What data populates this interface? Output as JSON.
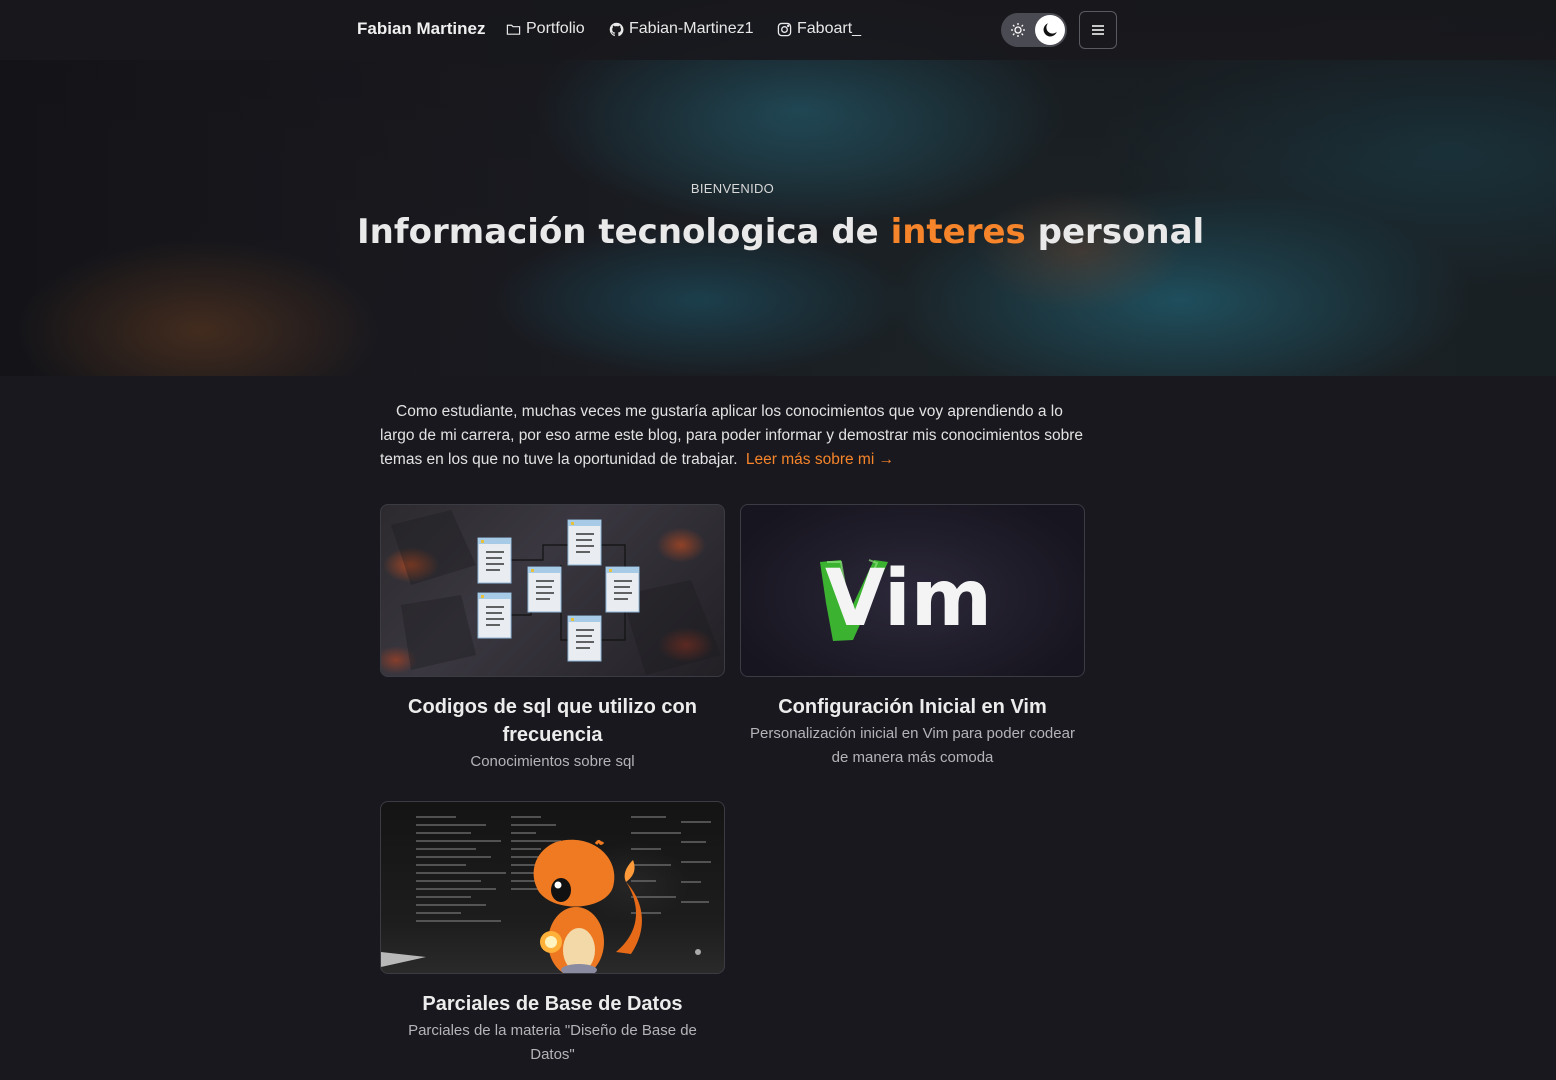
{
  "navbar": {
    "brand": "Fabian Martinez",
    "links": [
      {
        "label": "Portfolio",
        "icon": "folder-icon"
      },
      {
        "label": "Fabian-Martinez1",
        "icon": "github-icon"
      },
      {
        "label": "Faboart_",
        "icon": "instagram-icon"
      }
    ],
    "theme_toggle": {
      "state": "dark",
      "icons": [
        "sun-icon",
        "moon-icon"
      ]
    },
    "menu_icon": "hamburger-menu-icon"
  },
  "hero": {
    "eyebrow": "BIENVENIDO",
    "title_before": "Información tecnologica de ",
    "title_accent": "interes",
    "title_after": " personal"
  },
  "intro": {
    "text": "Como estudiante, muchas veces me gustaría aplicar los conocimientos que voy aprendiendo a lo largo de mi carrera, por eso arme este blog, para poder informar y demostrar mis conocimientos sobre temas en los que no tuve la oportunidad de trabajar.",
    "link_label": "Leer más sobre mi →"
  },
  "posts": [
    {
      "title": "Codigos de sql que utilizo con frecuencia",
      "description": "Conocimientos sobre sql",
      "image": "sql-diagram"
    },
    {
      "title": "Configuración Inicial en Vim",
      "description": "Personalización inicial en Vim para poder codear de manera más comoda",
      "image": "vim-logo",
      "logo_text": "Vim"
    },
    {
      "title": "Parciales de Base de Datos",
      "description": "Parciales de la materia \"Diseño de Base de Datos\"",
      "image": "charmander-code"
    }
  ],
  "colors": {
    "background": "#19181e",
    "accent": "#f5842a",
    "text": "#e6e6e6",
    "muted": "#b4b4b8"
  }
}
